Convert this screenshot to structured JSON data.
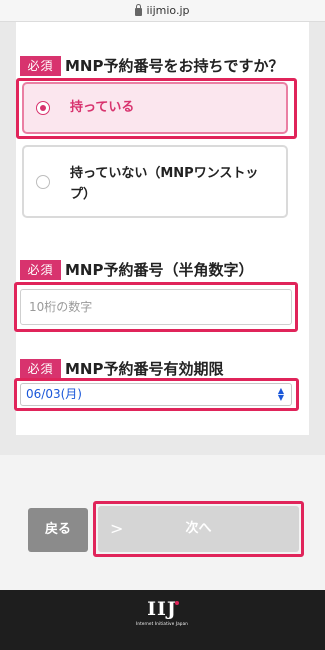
{
  "browser": {
    "url": "iijmio.jp"
  },
  "form": {
    "required_badge": "必須",
    "q1": {
      "label": "MNP予約番号をお持ちですか？",
      "options": [
        {
          "label": "持っている",
          "selected": true
        },
        {
          "label": "持っていない（MNPワンストップ）",
          "selected": false
        }
      ]
    },
    "q2": {
      "label": "MNP予約番号（半角数字）",
      "placeholder": "10桁の数字",
      "value": ""
    },
    "q3": {
      "label": "MNP予約番号有効期限",
      "selected_value": "06/03(月)"
    }
  },
  "buttons": {
    "back_label": "戻る",
    "next_label": "次へ"
  },
  "footer": {
    "logo_text": "IIJ",
    "logo_tagline": "Internet Initiative Japan"
  },
  "colors": {
    "accent": "#d8336e",
    "highlight": "#e0245a",
    "select_text": "#1a57d9"
  }
}
